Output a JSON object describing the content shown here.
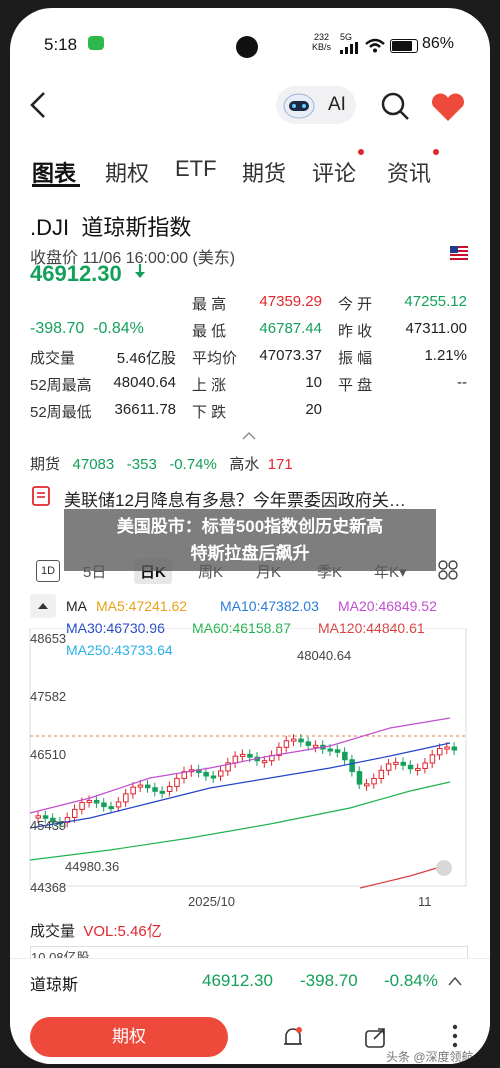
{
  "status": {
    "time": "5:18",
    "net_speed_top": "232",
    "net_speed_bottom": "KB/s",
    "signal": "5G",
    "battery": "86%"
  },
  "header": {
    "ai_label": "AI"
  },
  "tabs": [
    "图表",
    "期权",
    "ETF",
    "期货",
    "评论",
    "资讯"
  ],
  "stock": {
    "code": ".DJI",
    "name": "道琼斯指数",
    "close_info": "收盘价 11/06 16:00:00 (美东)"
  },
  "quote": {
    "price": "46912.30",
    "change": "-398.70",
    "change_pct": "-0.84%",
    "high_label": "最  高",
    "high": "47359.29",
    "open_label": "今  开",
    "open": "47255.12",
    "low_label": "最  低",
    "low": "46787.44",
    "prev_label": "昨  收",
    "prev": "47311.00",
    "vol_label": "成交量",
    "vol": "5.46亿股",
    "avg_label": "平均价",
    "avg": "47073.37",
    "amp_label": "振  幅",
    "amp": "1.21%",
    "h52_label": "52周最高",
    "h52": "48040.64",
    "up_label": "上  涨",
    "up": "10",
    "flat_label": "平  盘",
    "flat": "--",
    "l52_label": "52周最低",
    "l52": "36611.78",
    "down_label": "下  跌",
    "down": "20"
  },
  "futures": {
    "label": "期货",
    "price": "47083",
    "change": "-353",
    "pct": "-0.74%",
    "tide_label": "高水",
    "tide": "171"
  },
  "news_ticker": "美联储12月降息有多悬？今年票委因政府关…",
  "overlay_text": [
    "美国股市：标普500指数创历史新高",
    "特斯拉盘后飙升"
  ],
  "period_tabs": [
    "1D",
    "5日",
    "日K",
    "周K",
    "月K",
    "季K",
    "年K▾"
  ],
  "ma": {
    "label": "MA",
    "ma5": "MA5:47241.62",
    "ma10": "MA10:47382.03",
    "ma20": "MA20:46849.52",
    "ma30": "MA30:46730.96",
    "ma60": "MA60:46158.87",
    "ma120": "MA120:44840.61",
    "ma250": "MA250:43733.64"
  },
  "yaxis": [
    "48653",
    "47582",
    "46510",
    "45439",
    "44368"
  ],
  "annotations": {
    "high": "48040.64",
    "low": "44980.36"
  },
  "xaxis": {
    "date": "2025/10",
    "month": "11"
  },
  "volume": {
    "label": "成交量",
    "vol": "VOL:5.46亿",
    "top": "10.08亿股"
  },
  "bottom": {
    "name": "道琼斯",
    "price": "46912.30",
    "change": "-398.70",
    "pct": "-0.84%",
    "option_btn": "期权"
  },
  "watermark": "头条 @深度领航",
  "colors": {
    "up": "#e0262e",
    "down": "#14a05a",
    "accent": "#ee4a3c"
  }
}
